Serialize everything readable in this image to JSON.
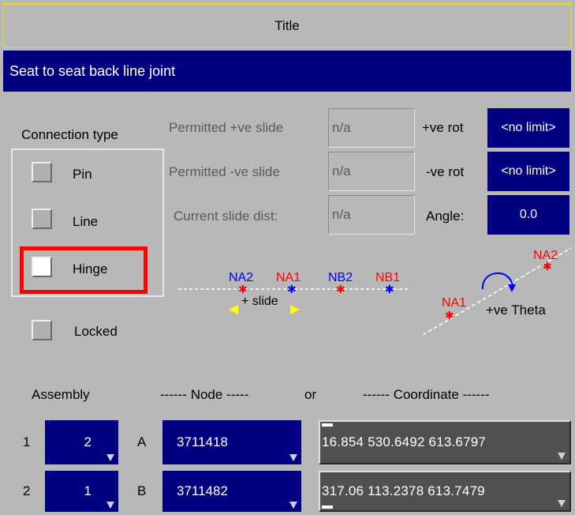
{
  "header": {
    "title": "Title",
    "name_value": "Seat to seat back line joint"
  },
  "connection": {
    "label": "Connection type",
    "options": [
      "Pin",
      "Line",
      "Hinge"
    ],
    "selected": "Hinge",
    "locked_label": "Locked"
  },
  "slide": {
    "permitted_pos_label": "Permitted +ve slide",
    "permitted_pos_value": "n/a",
    "permitted_neg_label": "Permitted -ve slide",
    "permitted_neg_value": "n/a",
    "current_label": "Current slide dist:",
    "current_value": "n/a"
  },
  "rotation": {
    "pos_label": "+ve rot",
    "pos_value": "<no limit>",
    "neg_label": "-ve rot",
    "neg_value": "<no limit>",
    "angle_label": "Angle:",
    "angle_value": "0.0"
  },
  "diagram": {
    "slide_labels": [
      "NA2",
      "NA1",
      "NB2",
      "NB1"
    ],
    "slide_caption": "+ slide",
    "hinge_labels": [
      "NA2",
      "NA1"
    ],
    "theta_caption": "+ve Theta"
  },
  "table": {
    "assembly_header": "Assembly",
    "node_header": "------ Node -----",
    "or_label": "or",
    "coord_header": "------ Coordinate ------",
    "rows": [
      {
        "index": "1",
        "assembly": "2",
        "letter": "A",
        "node": "3711418",
        "coordinate": "16.854  530.6492  613.6797"
      },
      {
        "index": "2",
        "assembly": "1",
        "letter": "B",
        "node": "3711482",
        "coordinate": "317.06  113.2378  613.7479"
      }
    ]
  },
  "colors": {
    "panel": "#b8b8b8",
    "navy": "#000080",
    "highlight": "#ff0000",
    "title_border": "#f0e000"
  }
}
